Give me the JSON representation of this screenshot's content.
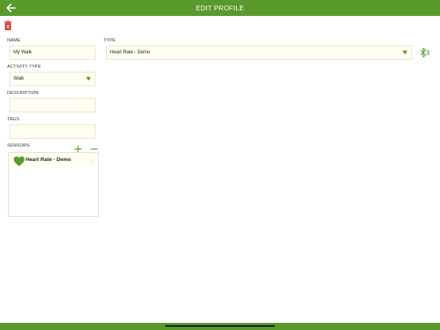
{
  "header": {
    "title": "EDIT PROFILE",
    "back_icon": "arrow-left-icon"
  },
  "toolbar": {
    "delete_icon": "trash-icon"
  },
  "form": {
    "name": {
      "label": "NAME",
      "value": "My Walk"
    },
    "type": {
      "label": "TYPE",
      "value": "Heart Rate - Demo",
      "bluetooth_icon": "bluetooth-icon"
    },
    "activity_type": {
      "label": "ACTIVITY TYPE",
      "value": "Walk"
    },
    "description": {
      "label": "DESCRIPTION",
      "value": ""
    },
    "tags": {
      "label": "TAGS",
      "value": ""
    }
  },
  "sensors": {
    "label": "SENSORS",
    "add_icon": "plus-icon",
    "remove_icon": "minus-icon",
    "items": [
      {
        "name": "Heart Rate - Demo",
        "icon": "heart-icon"
      }
    ]
  },
  "colors": {
    "accent": "#5a9a2c",
    "field_bg": "#fffef0",
    "delete": "#d9342b"
  }
}
